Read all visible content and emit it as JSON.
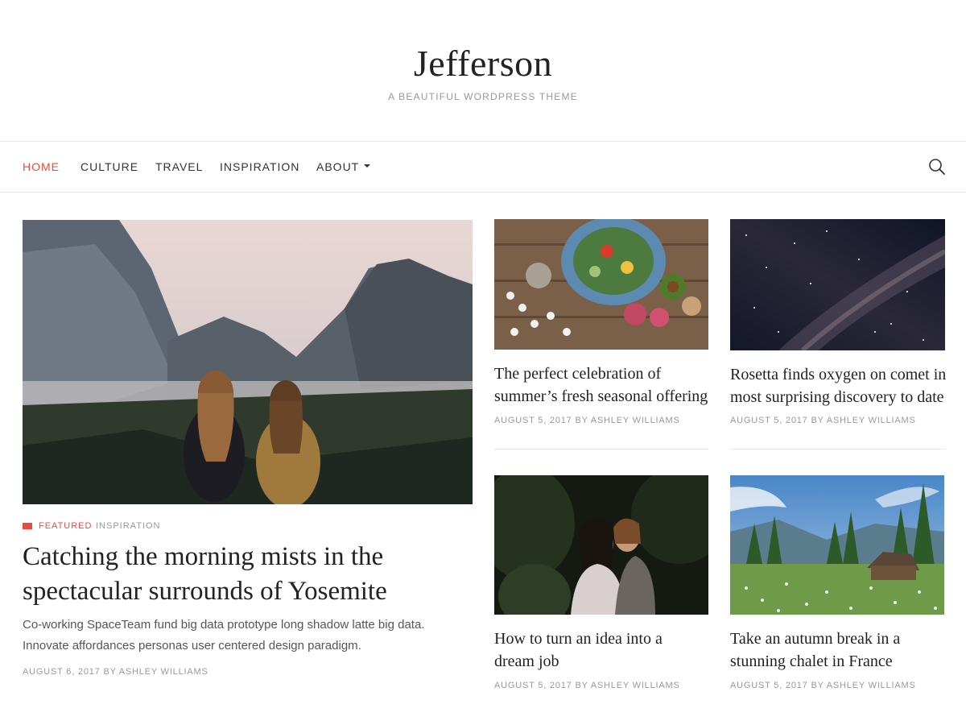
{
  "site": {
    "title": "Jefferson",
    "tagline": "A BEAUTIFUL WORDPRESS THEME"
  },
  "nav": {
    "items": [
      {
        "label": "HOME",
        "active": true
      },
      {
        "label": "CULTURE",
        "active": false
      },
      {
        "label": "TRAVEL",
        "active": false
      },
      {
        "label": "INSPIRATION",
        "active": false
      },
      {
        "label": "ABOUT",
        "active": false,
        "has_dropdown": true
      }
    ],
    "search_icon": "search-icon",
    "accent_color": "#e84c3d"
  },
  "featured": {
    "categories": [
      "FEATURED",
      "INSPIRATION"
    ],
    "title_line1": "Catching the morning mists in the",
    "title_line2": "spectacular surrounds of Yosemite",
    "excerpt_line1": "Co-working SpaceTeam fund big data prototype long shadow latte big data.",
    "excerpt_line2": "Innovate affordances personas user centered design paradigm.",
    "meta": "AUGUST 6, 2017 BY ASHLEY WILLIAMS",
    "image": "two women overlooking misty Yosemite valley"
  },
  "posts": [
    {
      "title_line1": "The perfect celebration of",
      "title_line2": "summer’s fresh seasonal offering",
      "meta": "AUGUST 5, 2017 BY ASHLEY WILLIAMS",
      "image": "salad bowl on wooden table"
    },
    {
      "title_line1": "Rosetta finds oxygen on comet in",
      "title_line2": "most surprising discovery to date",
      "meta": "AUGUST 5, 2017 BY ASHLEY WILLIAMS",
      "image": "milky way night sky"
    },
    {
      "title_line1": "How to turn an idea into a",
      "title_line2": "dream job",
      "meta": "AUGUST 5, 2017 BY ASHLEY WILLIAMS",
      "image": "couple embracing in forest"
    },
    {
      "title_line1": "Take an autumn break in a",
      "title_line2": "stunning chalet in France",
      "meta": "AUGUST 5, 2017 BY ASHLEY WILLIAMS",
      "image": "wooden chalet in flower meadow"
    }
  ]
}
